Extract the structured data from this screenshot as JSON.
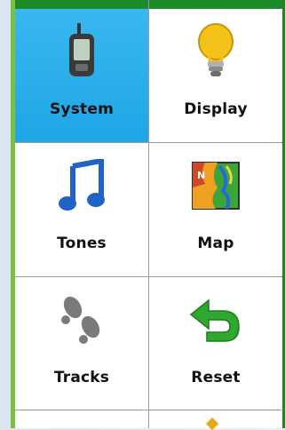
{
  "menu": {
    "items": [
      {
        "label": "System",
        "icon": "handheld-gps-icon",
        "selected": true
      },
      {
        "label": "Display",
        "icon": "lightbulb-icon",
        "selected": false
      },
      {
        "label": "Tones",
        "icon": "music-note-icon",
        "selected": false
      },
      {
        "label": "Map",
        "icon": "map-icon",
        "selected": false
      },
      {
        "label": "Tracks",
        "icon": "footprints-icon",
        "selected": false
      },
      {
        "label": "Reset",
        "icon": "reset-arrow-icon",
        "selected": false
      }
    ]
  },
  "colors": {
    "selected_tile": "#25aeea",
    "frame_green_light": "#7fbf3f",
    "frame_green_dark": "#1e8b2a"
  }
}
